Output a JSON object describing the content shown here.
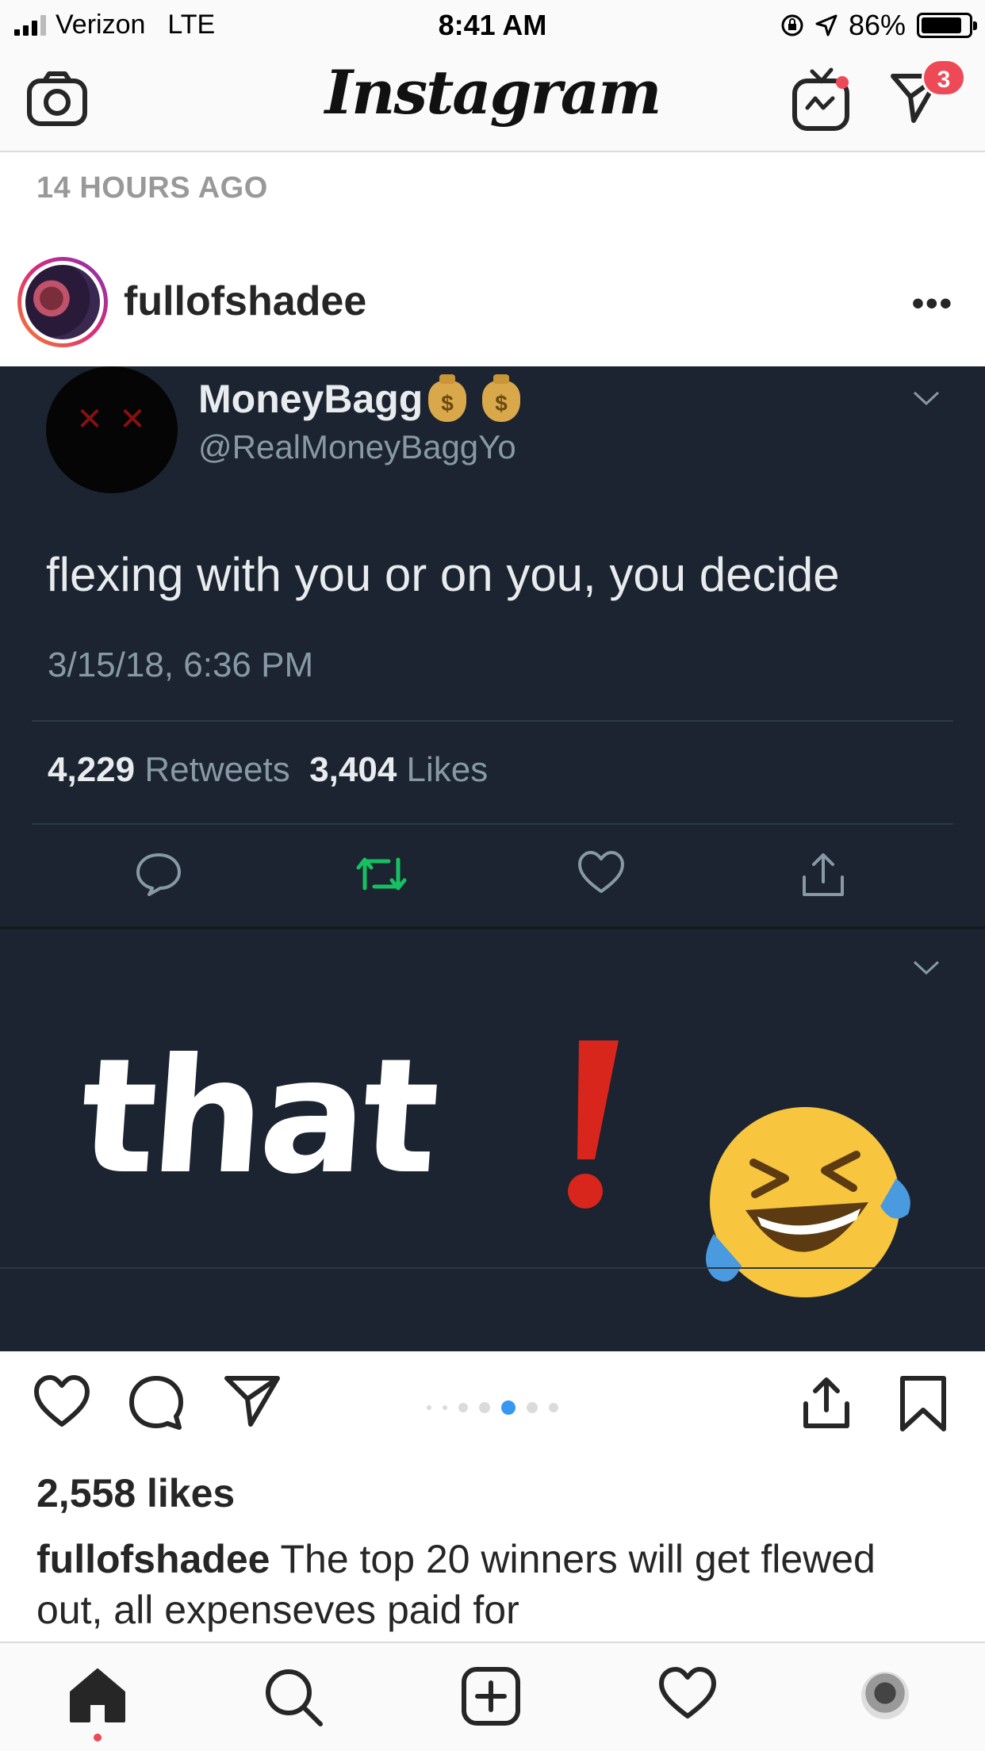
{
  "status_bar": {
    "carrier": "Verizon",
    "network": "LTE",
    "time": "8:41 AM",
    "battery": "86%",
    "battery_level": 0.86
  },
  "header": {
    "title": "Instagram",
    "dm_badge": "3",
    "icons": [
      "camera-icon",
      "igtv-icon",
      "direct-message-icon"
    ]
  },
  "post": {
    "time_ago": "14 HOURS AGO",
    "username": "fullofshadee",
    "more": "•••",
    "likes": "2,558 likes",
    "caption_user": "fullofshadee",
    "caption_text": " The top 20 winners will get flewed out, all expenseves paid for",
    "carousel": {
      "count": 7,
      "active_index": 4
    },
    "accent_color": "#3897f0"
  },
  "tweet": {
    "name": "MoneyBagg",
    "bag_symbol": "$",
    "handle": "@RealMoneyBaggYo",
    "text": "flexing with you or on you, you decide",
    "date": "3/15/18, 6:36 PM",
    "retweets_count": "4,229",
    "retweets_label": " Retweets",
    "likes_count": "3,404",
    "likes_label": " Likes",
    "retweet_color": "#17bf63",
    "reply_text": "that"
  },
  "tab_bar": {
    "items": [
      "home-icon",
      "search-icon",
      "new-post-icon",
      "activity-icon",
      "profile-icon"
    ]
  }
}
